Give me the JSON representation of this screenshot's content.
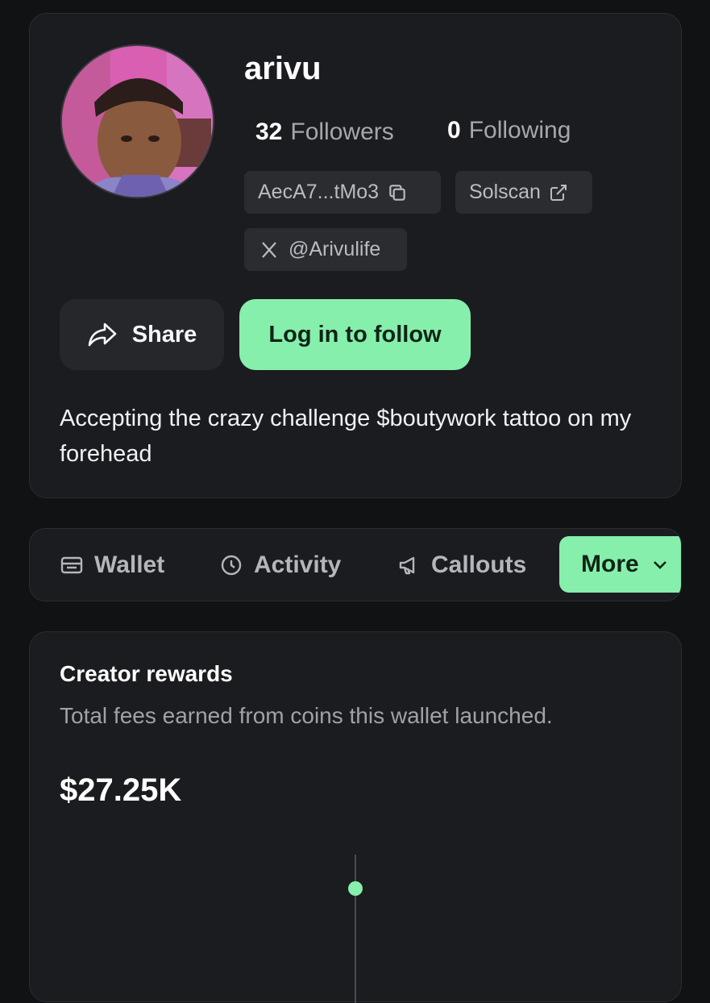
{
  "profile": {
    "username": "arivu",
    "followers_count": "32",
    "followers_label": "Followers",
    "following_count": "0",
    "following_label": "Following",
    "address_short": "AecA7...tMo3",
    "solscan_label": "Solscan",
    "x_handle": "@Arivulife",
    "share_label": "Share",
    "follow_label": "Log in to follow",
    "bio": "Accepting the crazy challenge $boutywork tattoo on my forehead"
  },
  "tabs": {
    "wallet": "Wallet",
    "activity": "Activity",
    "callouts": "Callouts",
    "more": "More"
  },
  "rewards": {
    "title": "Creator rewards",
    "subtitle": "Total fees earned from coins this wallet launched.",
    "amount": "$27.25K"
  },
  "colors": {
    "accent": "#86efac",
    "background": "#111214",
    "card": "#1b1c1f",
    "chip": "#2a2c30"
  },
  "icons": [
    "copy-icon",
    "external-link-icon",
    "x-logo-icon",
    "share-icon",
    "wallet-icon",
    "clock-icon",
    "megaphone-icon",
    "chevron-down-icon"
  ]
}
